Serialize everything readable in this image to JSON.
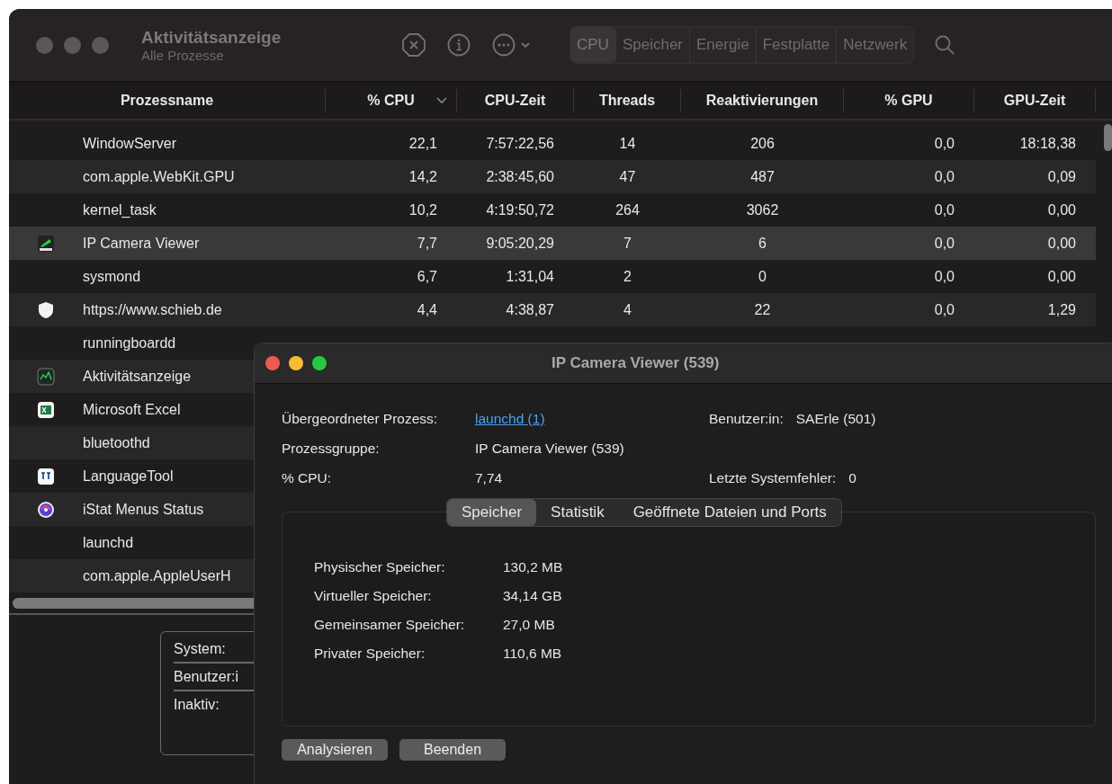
{
  "window": {
    "title": "Aktivitätsanzeige",
    "subtitle": "Alle Prozesse"
  },
  "tabs": [
    {
      "label": "CPU",
      "selected": true
    },
    {
      "label": "Speicher",
      "selected": false
    },
    {
      "label": "Energie",
      "selected": false
    },
    {
      "label": "Festplatte",
      "selected": false
    },
    {
      "label": "Netzwerk",
      "selected": false
    }
  ],
  "table": {
    "columns": [
      {
        "label": "Prozessname",
        "sorted": false
      },
      {
        "label": "% CPU",
        "sorted": true
      },
      {
        "label": "CPU-Zeit",
        "sorted": false
      },
      {
        "label": "Threads",
        "sorted": false
      },
      {
        "label": "Reaktivierungen",
        "sorted": false
      },
      {
        "label": "% GPU",
        "sorted": false
      },
      {
        "label": "GPU-Zeit",
        "sorted": false
      }
    ],
    "rows": [
      {
        "name": "WindowServer",
        "selected": false,
        "cells": [
          "22,1",
          "7:57:22,56",
          "14",
          "206",
          "0,0",
          "18:18,38"
        ]
      },
      {
        "name": "com.apple.WebKit.GPU",
        "selected": false,
        "cells": [
          "14,2",
          "2:38:45,60",
          "47",
          "487",
          "0,0",
          "0,09"
        ]
      },
      {
        "name": "kernel_task",
        "selected": false,
        "cells": [
          "10,2",
          "4:19:50,72",
          "264",
          "3062",
          "0,0",
          "0,00"
        ]
      },
      {
        "name": "IP Camera Viewer",
        "kind": "viewer",
        "selected": true,
        "cells": [
          "7,7",
          "9:05:20,29",
          "7",
          "6",
          "0,0",
          "0,00"
        ]
      },
      {
        "name": "sysmond",
        "selected": false,
        "cells": [
          "6,7",
          "1:31,04",
          "2",
          "0",
          "0,0",
          "0,00"
        ]
      },
      {
        "name": "https://www.schieb.de",
        "kind": "shield",
        "selected": false,
        "cells": [
          "4,4",
          "4:38,87",
          "4",
          "22",
          "0,0",
          "1,29"
        ]
      },
      {
        "name": "runningboardd",
        "selected": false
      },
      {
        "name": "Aktivitätsanzeige",
        "kind": "monitor",
        "selected": false
      },
      {
        "name": "Microsoft Excel",
        "kind": "spreadsheet",
        "selected": false
      },
      {
        "name": "bluetoothd",
        "selected": false
      },
      {
        "name": "LanguageTool",
        "kind": "lt",
        "selected": false
      },
      {
        "name": "iStat Menus Status",
        "kind": "gauge",
        "selected": false
      },
      {
        "name": "launchd",
        "selected": false
      },
      {
        "name": "com.apple.AppleUserH",
        "selected": false
      }
    ]
  },
  "summary": [
    "System:",
    "Benutzer:i",
    "Inaktiv:"
  ],
  "dialog": {
    "title": "IP Camera Viewer (539)",
    "info": [
      {
        "label": "Übergeordneter Prozess:",
        "value": "launchd (1)",
        "kind": "link"
      },
      {
        "label": "Benutzer:in:",
        "value": "SAErle (501)",
        "kind": "text"
      },
      {
        "label": "Prozessgruppe:",
        "value": "IP Camera Viewer (539)",
        "kind": "text"
      },
      {
        "label": "% CPU:",
        "value": "7,74",
        "kind": "text"
      },
      {
        "label": "Letzte Systemfehler:",
        "value": "0",
        "kind": "text"
      }
    ],
    "tabs": [
      {
        "label": "Speicher",
        "selected": true
      },
      {
        "label": "Statistik",
        "selected": false
      },
      {
        "label": "Geöffnete Dateien und Ports",
        "selected": false
      }
    ],
    "memory": [
      {
        "label": "Physischer Speicher:",
        "value": "130,2 MB"
      },
      {
        "label": "Virtueller Speicher:",
        "value": "34,14 GB"
      },
      {
        "label": "Gemeinsamer Speicher:",
        "value": "27,0 MB"
      },
      {
        "label": "Privater Speicher:",
        "value": "110,6 MB"
      }
    ],
    "buttons": [
      "Analysieren",
      "Beenden"
    ]
  }
}
